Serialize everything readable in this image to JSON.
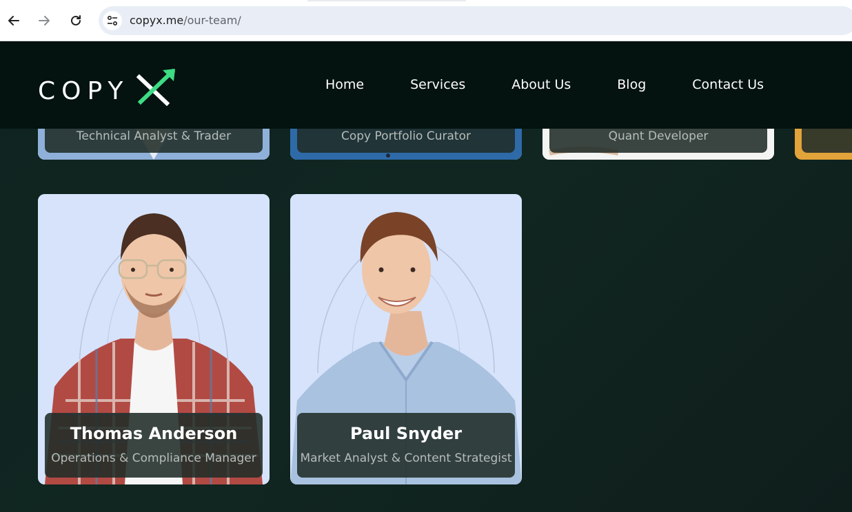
{
  "browser": {
    "url_domain": "copyx.me",
    "url_path": "/our-team/"
  },
  "header": {
    "logo_text": "COPY",
    "logo_accent": "X",
    "nav": [
      {
        "label": "Home"
      },
      {
        "label": "Services"
      },
      {
        "label": "About Us"
      },
      {
        "label": "Blog"
      },
      {
        "label": "Contact Us"
      }
    ]
  },
  "team_top_row": [
    {
      "role": "Technical Analyst & Trader"
    },
    {
      "role": "Copy Portfolio Curator"
    },
    {
      "role": "Quant Developer"
    }
  ],
  "team_bottom_row": [
    {
      "name": "Thomas Anderson",
      "role": "Operations & Compliance Manager"
    },
    {
      "name": "Paul Snyder",
      "role": "Market Analyst & Content Strategist"
    }
  ],
  "colors": {
    "brand_green": "#3ddc84",
    "header_bg": "#041310",
    "page_bg": "#0f2420",
    "card_bg": "#d6e3fb"
  }
}
